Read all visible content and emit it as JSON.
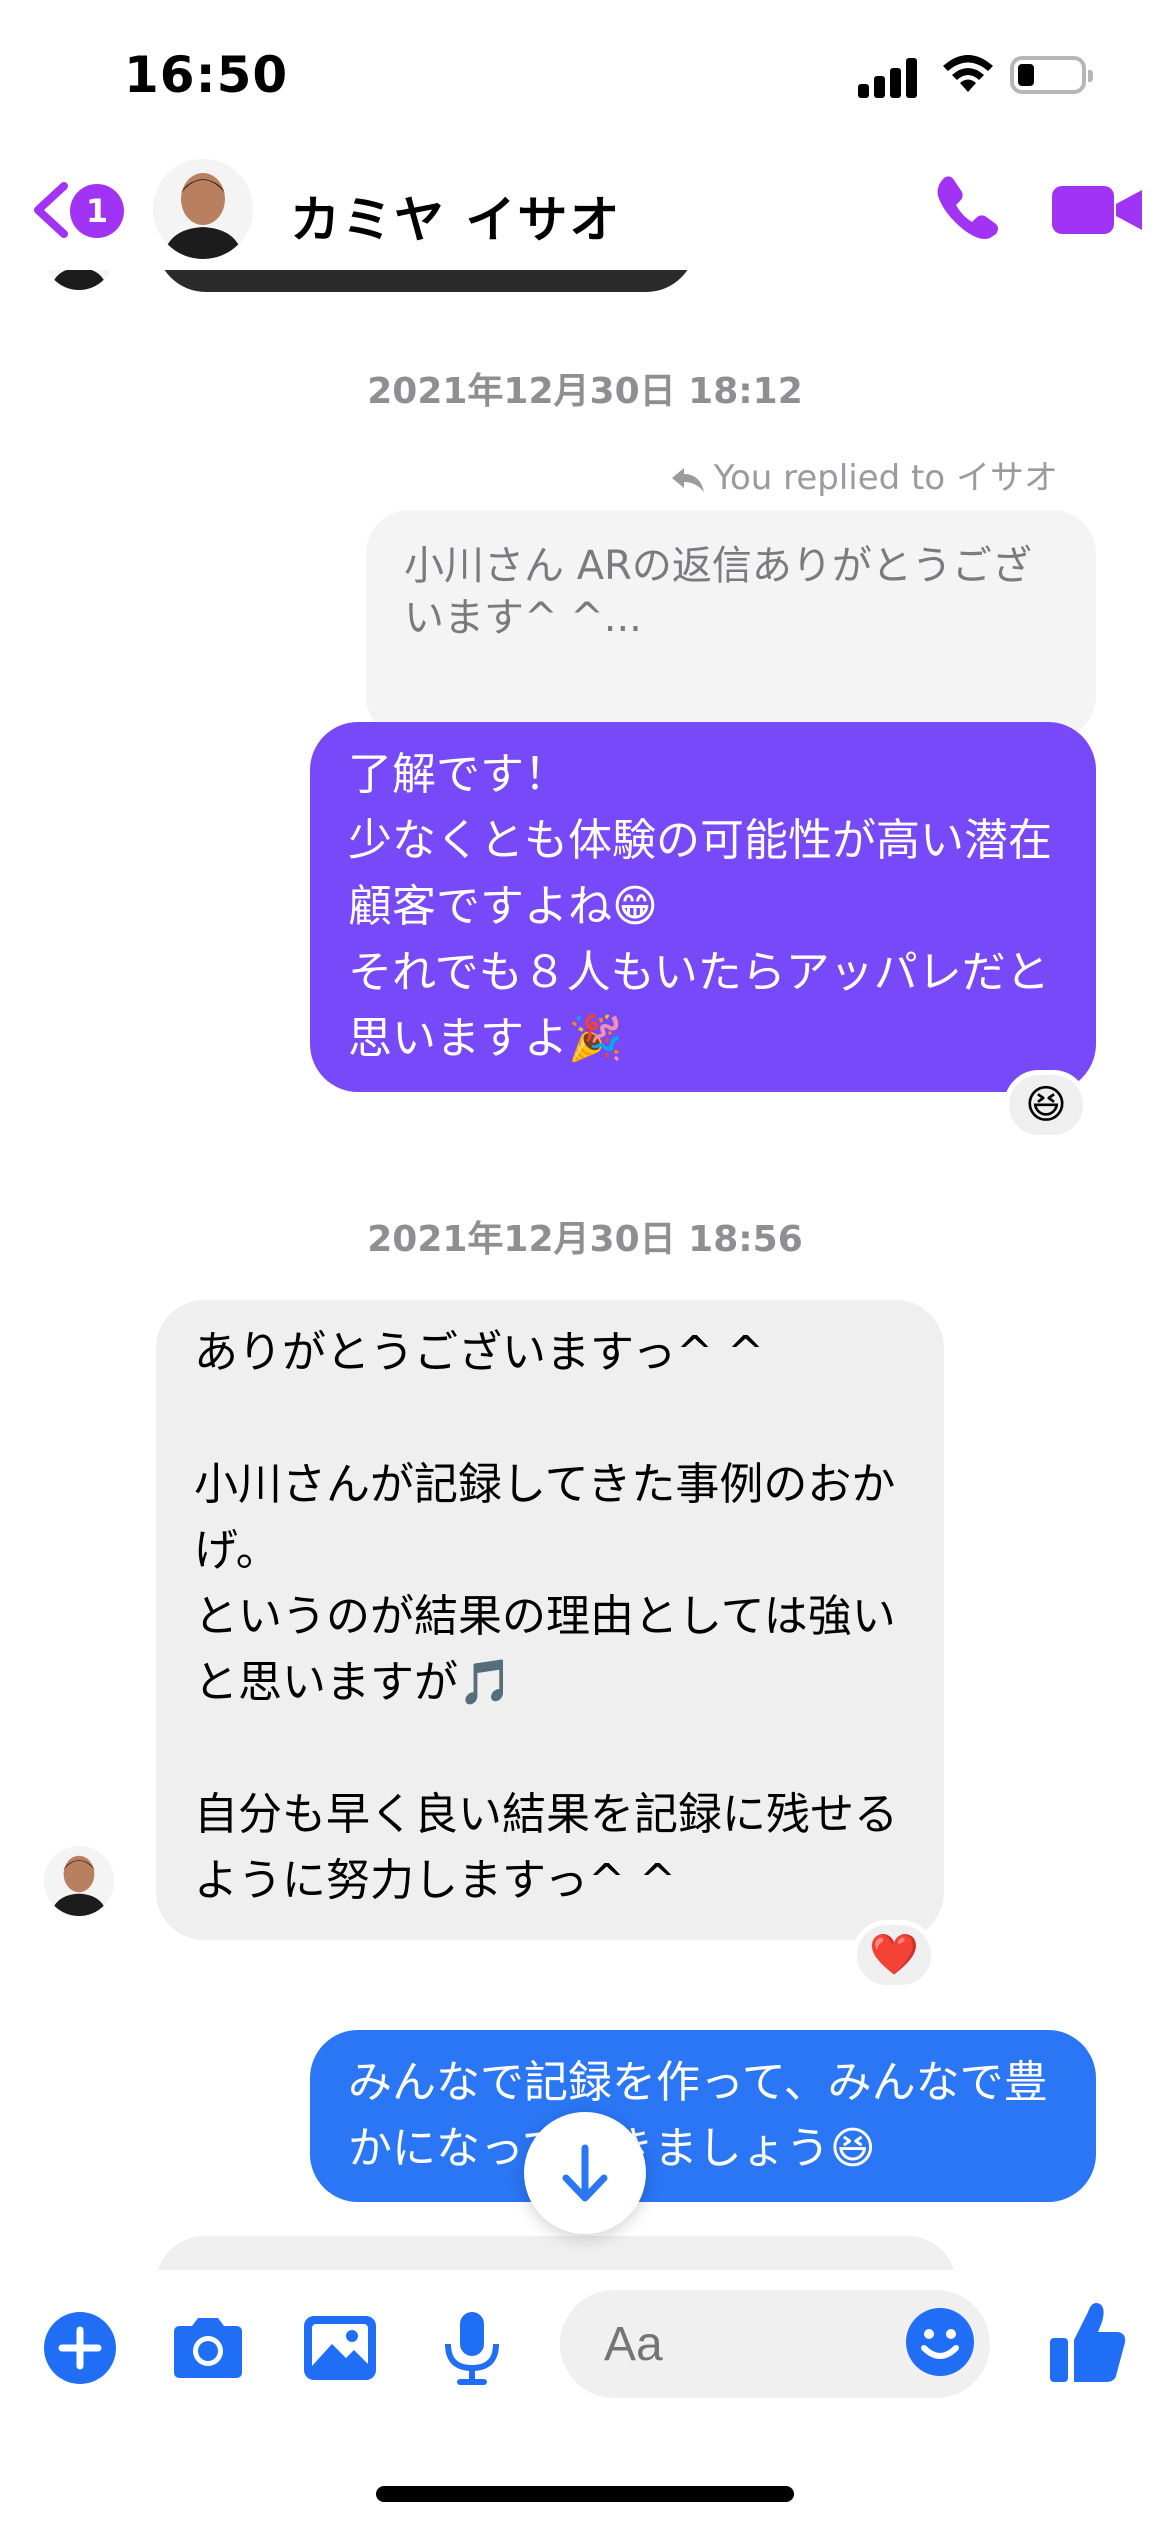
{
  "status_bar": {
    "time": "16:50"
  },
  "header": {
    "back_badge": "1",
    "contact_name": "カミヤ イサオ"
  },
  "messages": {
    "timestamp_1": "2021年12月30日 18:12",
    "reply_note": "You replied to イサオ",
    "quoted_text": "小川さん ARの返信ありがとうございます^ ^...",
    "msg_1_text": "了解です！\n少なくとも体験の可能性が高い潜在顧客ですよね😁\nそれでも８人もいたらアッパレだと思いますよ🎉",
    "msg_1_reaction": "😆",
    "timestamp_2": "2021年12月30日 18:56",
    "msg_2_text": "ありがとうございますっ^ ^\n\n小川さんが記録してきた事例のおかげ。\nというのが結果の理由としては強いと思いますが🎵\n\n自分も早く良い結果を記録に残せるように努力しますっ^ ^",
    "msg_2_reaction": "❤️",
    "msg_3_text": "みんなで記録を作って、みんなで豊かになっていきましょう😆"
  },
  "composer": {
    "placeholder": "Aa"
  },
  "colors": {
    "accent_purple": "#a133f5",
    "bubble_purple": "#7749f8",
    "bubble_blue": "#2b76f5",
    "bubble_in": "#efefef"
  }
}
